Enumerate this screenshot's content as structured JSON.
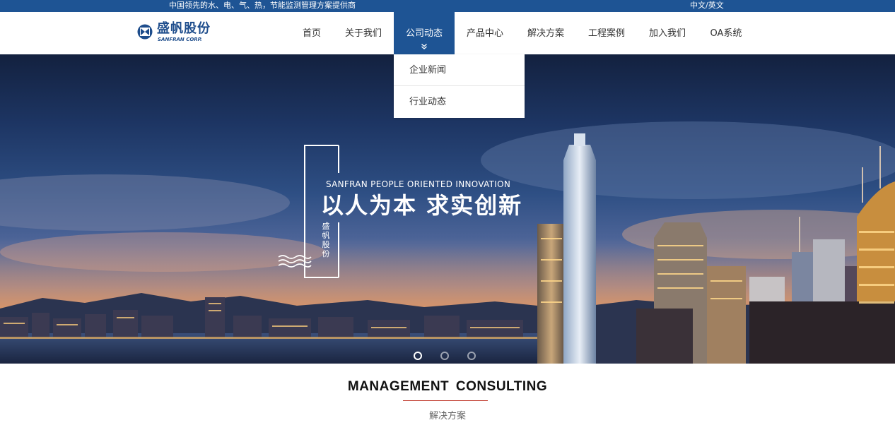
{
  "topbar": {
    "slogan": "中国领先的水、电、气、热，节能监测管理方案提供商",
    "language_switch": "中文/英文"
  },
  "brand": {
    "name_cn": "盛帆股份",
    "name_en": "SANFRAN CORP."
  },
  "nav": {
    "items": [
      {
        "label": "首页"
      },
      {
        "label": "关于我们"
      },
      {
        "label": "公司动态",
        "active": true
      },
      {
        "label": "产品中心"
      },
      {
        "label": "解决方案"
      },
      {
        "label": "工程案例"
      },
      {
        "label": "加入我们"
      },
      {
        "label": "OA系统"
      }
    ]
  },
  "dropdown": {
    "items": [
      {
        "label": "企业新闻"
      },
      {
        "label": "行业动态"
      }
    ]
  },
  "banner": {
    "tagline_en": "SANFRAN  PEOPLE ORIENTED INNOVATION",
    "tagline_cn": "以人为本 求实创新",
    "vertical_text": "盛帆股份",
    "slide_count": 3,
    "active_slide": 1
  },
  "section": {
    "title": "MANAGEMENT  CONSULTING",
    "subtitle": "解决方案"
  },
  "colors": {
    "brand_blue": "#1e5494",
    "accent_red": "#c0392b",
    "text_dark": "#333333"
  },
  "icons": {
    "logo": "sanfran-logo-icon",
    "chevron": "double-chevron-down-icon",
    "waves": "waves-icon"
  }
}
